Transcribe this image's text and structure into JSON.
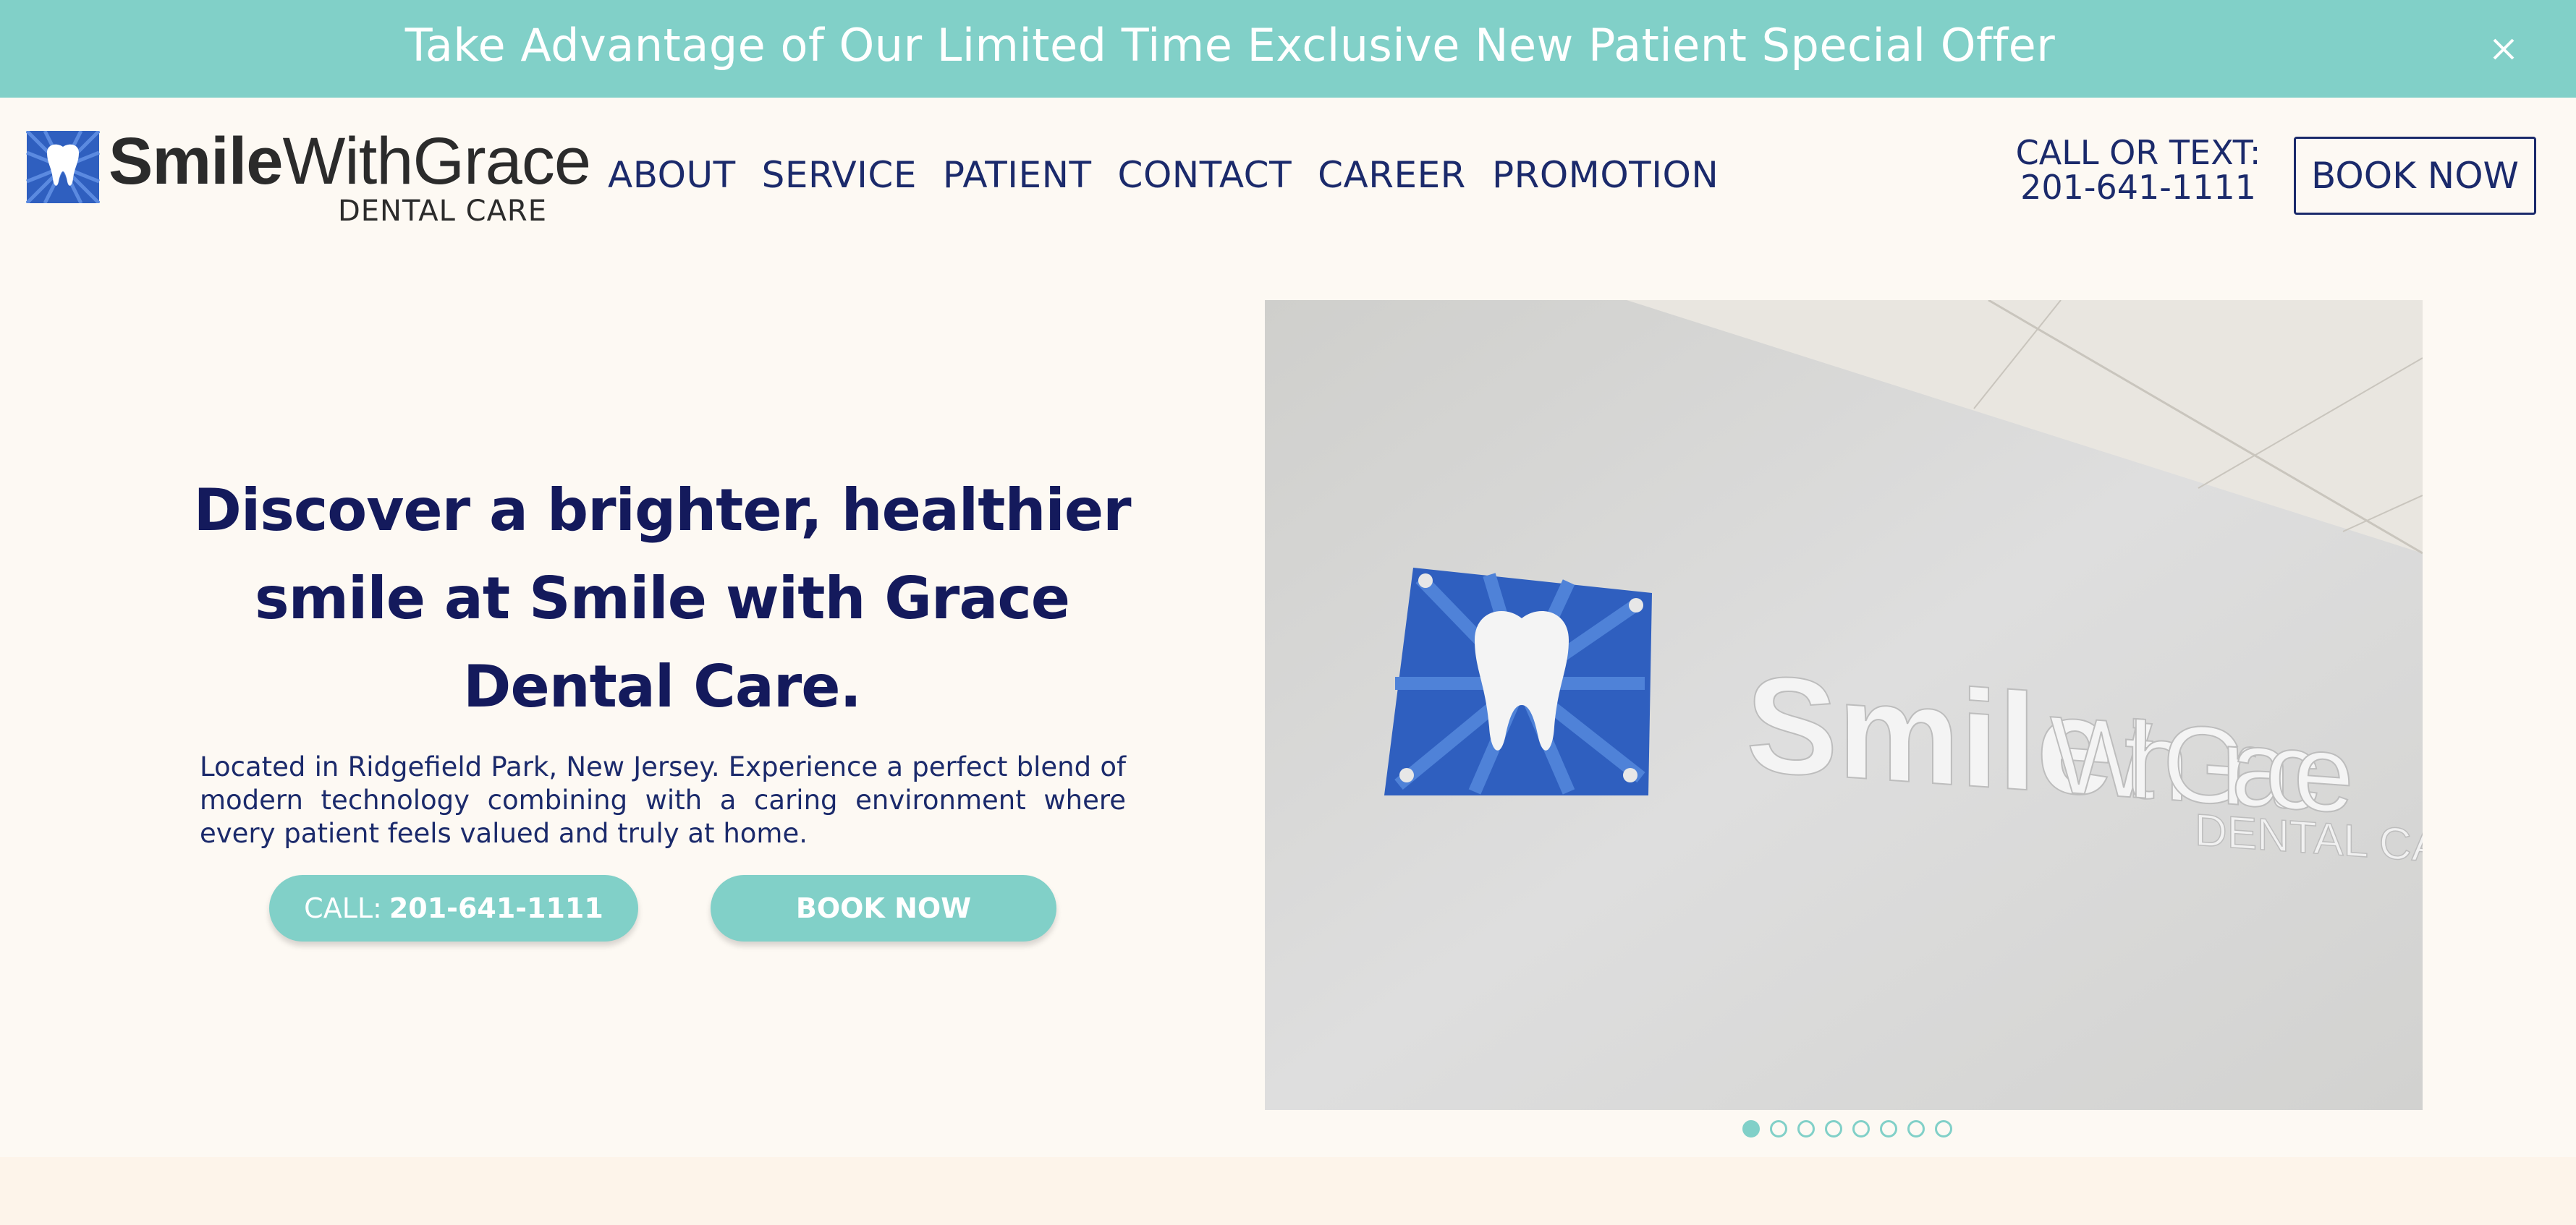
{
  "banner": {
    "text": "Take Advantage of Our Limited Time Exclusive New Patient Special Offer",
    "close_icon": "close-icon"
  },
  "logo": {
    "bold": "Smile",
    "light": "WithGrace",
    "sub": "DENTAL CARE",
    "icon": "tooth-icon"
  },
  "nav": {
    "items": [
      "ABOUT",
      "SERVICE",
      "PATIENT",
      "CONTACT",
      "CAREER",
      "PROMOTION"
    ]
  },
  "header": {
    "call_label": "CALL OR TEXT:",
    "call_number": "201-641-1111",
    "book_label": "BOOK NOW"
  },
  "hero": {
    "title_line1": "Discover a brighter, healthier",
    "title_line2": "smile at Smile with Grace",
    "title_line3": "Dental Care.",
    "description": "Located in Ridgefield Park, New Jersey. Experience a perfect blend of modern technology combining with a caring environment where every patient feels valued and truly at home.",
    "call_prefix": "CALL:",
    "call_number": "201-641-1111",
    "book_label": "BOOK NOW"
  },
  "slider": {
    "sign_bold": "Smile",
    "sign_light": "WithGrace",
    "sign_sub": "DENTAL CARE",
    "dots": 8,
    "active_dot": 0
  },
  "colors": {
    "accent": "#81d0c8",
    "navy": "#1b2a6b",
    "title": "#141a5c",
    "background": "#fdf9f3",
    "logo_blue": "#2f5fbf"
  }
}
